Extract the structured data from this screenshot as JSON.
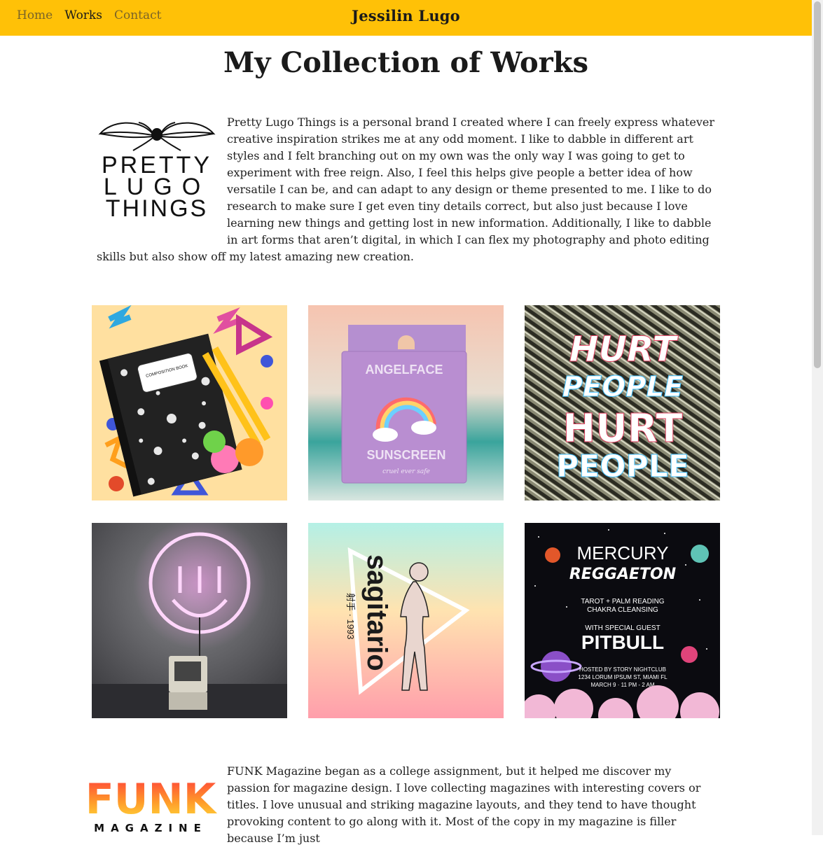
{
  "nav": {
    "links": [
      {
        "label": "Home",
        "active": false
      },
      {
        "label": "Works",
        "active": true
      },
      {
        "label": "Contact",
        "active": false
      }
    ],
    "brand": "Jessilin Lugo",
    "bg_color": "#ffc107"
  },
  "page": {
    "title": "My Collection of Works"
  },
  "intro": {
    "logo_lines": [
      "PRETTY",
      "LUGO",
      "THINGS"
    ],
    "text": "Pretty Lugo Things is a personal brand I created where I can freely express whatever creative inspiration strikes me at any odd moment. I like to dabble in different art styles and I felt branching out on my own was the only way I was going to get to experiment with free reign. Also, I feel this helps give people a better idea of how versatile I can be, and can adapt to any design or theme presented to me. I like to do research to make sure I get even tiny details correct, but also just because I love learning new things and getting lost in new information. Additionally, I like to dabble in art forms that aren’t digital, in which I can flex my photography and photo editing skills but also show off my latest amazing new creation."
  },
  "gallery": {
    "tiles": [
      {
        "name": "composition-notebook",
        "label": "COMPOSITION BOOK"
      },
      {
        "name": "angelface-sunscreen",
        "brand": "ANGELFACE",
        "product": "SUNSCREEN",
        "tagline": "cruel ever safe"
      },
      {
        "name": "hurt-people",
        "lines": [
          "HURT",
          "PEOPLE",
          "HURT",
          "PEOPLE"
        ]
      },
      {
        "name": "neon-smiley"
      },
      {
        "name": "sagitario",
        "word": "sagitario",
        "sub": "射手 · 1993"
      },
      {
        "name": "mercury-reggaeton",
        "title": "MERCURY",
        "subtitle": "REGGAETON",
        "line1": "TAROT + PALM READING",
        "line2": "CHAKRA CLEANSING",
        "line3": "WITH SPECIAL GUEST",
        "guest": "PITBULL",
        "info1": "HOSTED BY STORY NIGHTCLUB",
        "info2": "1234 LORUM IPSUM ST, MIAMI FL",
        "info3": "MARCH 9 · 11 PM - 2 AM"
      }
    ]
  },
  "funk": {
    "logo_word": "FUNK",
    "logo_sub": "MAGAZINE",
    "text": "FUNK Magazine began as a college assignment, but it helped me discover my passion for magazine design. I love collecting magazines with interesting covers or titles. I love unusual and striking magazine layouts, and they tend to have thought provoking content to go along with it. Most of the copy in my magazine is filler because I’m just"
  }
}
